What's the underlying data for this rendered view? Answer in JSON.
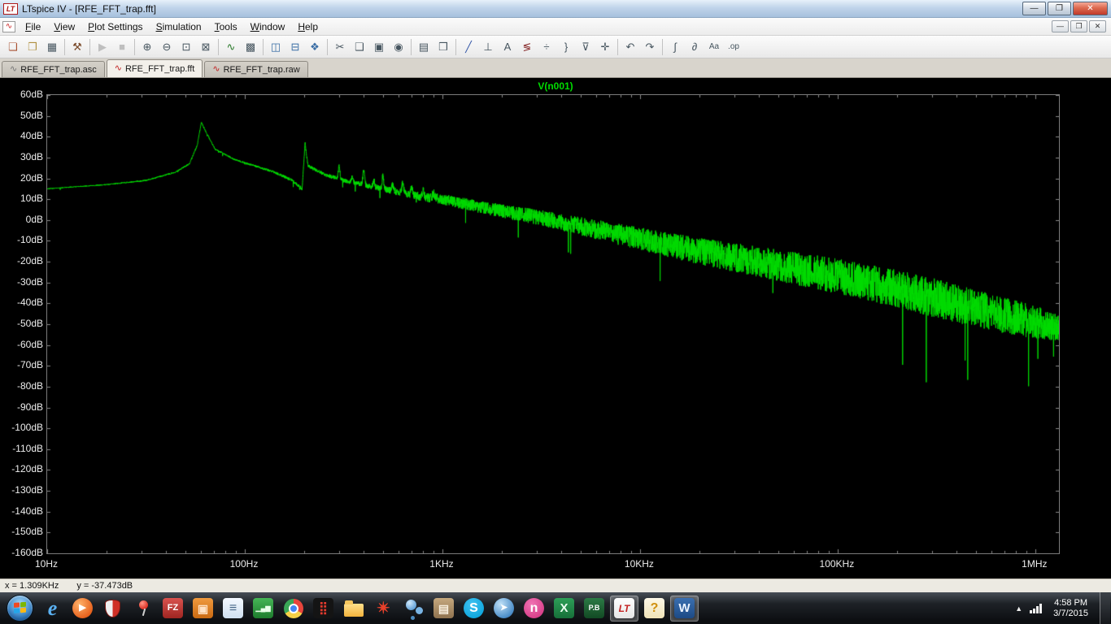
{
  "window": {
    "title": "LTspice IV - [RFE_FFT_trap.fft]",
    "logo_text": "LT",
    "controls": {
      "minimize": "—",
      "restore": "❐",
      "close": "✕"
    },
    "mdi_controls": {
      "minimize": "—",
      "restore": "❐",
      "close": "✕"
    }
  },
  "menu": {
    "doc_icon_glyph": "∿",
    "items": [
      "File",
      "View",
      "Plot Settings",
      "Simulation",
      "Tools",
      "Window",
      "Help"
    ]
  },
  "toolbar": {
    "buttons": [
      {
        "name": "new-schematic",
        "glyph": "❏",
        "fg": "#a85030"
      },
      {
        "name": "open",
        "glyph": "❐",
        "fg": "#b09040"
      },
      {
        "name": "save",
        "glyph": "▦",
        "fg": "#46555f"
      },
      {
        "sep": true
      },
      {
        "name": "control-panel",
        "glyph": "⚒",
        "fg": "#7a4a2a"
      },
      {
        "sep": true
      },
      {
        "name": "run",
        "glyph": "▶",
        "enabled": false
      },
      {
        "name": "halt",
        "glyph": "■",
        "enabled": false
      },
      {
        "sep": true
      },
      {
        "name": "zoom-in",
        "glyph": "⊕"
      },
      {
        "name": "zoom-out",
        "glyph": "⊖"
      },
      {
        "name": "zoom-area",
        "glyph": "⊡"
      },
      {
        "name": "zoom-full-extents",
        "glyph": "⊠"
      },
      {
        "sep": true
      },
      {
        "name": "autorange-y-axis",
        "glyph": "∿",
        "fg": "#2a7a2a"
      },
      {
        "name": "grid",
        "glyph": "▩"
      },
      {
        "sep": true
      },
      {
        "name": "tile-vertically",
        "glyph": "◫",
        "fg": "#3a6ea5"
      },
      {
        "name": "tile-horizontally",
        "glyph": "⊟",
        "fg": "#3a6ea5"
      },
      {
        "name": "cascade-windows",
        "glyph": "❖",
        "fg": "#3a6ea5"
      },
      {
        "sep": true
      },
      {
        "name": "cut",
        "glyph": "✂"
      },
      {
        "name": "copy",
        "glyph": "❑"
      },
      {
        "name": "paste",
        "glyph": "▣"
      },
      {
        "name": "find",
        "glyph": "◉"
      },
      {
        "sep": true
      },
      {
        "name": "print",
        "glyph": "▤"
      },
      {
        "name": "print-preview",
        "glyph": "❒"
      },
      {
        "sep": true
      },
      {
        "name": "draw-wire",
        "glyph": "╱",
        "fg": "#3558a8"
      },
      {
        "name": "ground",
        "glyph": "⊥"
      },
      {
        "name": "net-label",
        "glyph": "A"
      },
      {
        "name": "diode",
        "glyph": "≶",
        "fg": "#8a3030"
      },
      {
        "name": "capacitor",
        "glyph": "÷"
      },
      {
        "name": "inductor",
        "glyph": "}"
      },
      {
        "name": "component",
        "glyph": "⊽"
      },
      {
        "name": "move",
        "glyph": "✛"
      },
      {
        "sep": true
      },
      {
        "name": "undo",
        "glyph": "↶"
      },
      {
        "name": "redo",
        "glyph": "↷"
      },
      {
        "sep": true
      },
      {
        "name": "mirror",
        "glyph": "∫"
      },
      {
        "name": "rotate",
        "glyph": "∂"
      },
      {
        "name": "text",
        "glyph": "Aa"
      },
      {
        "name": "spice-directive",
        "glyph": ".op"
      }
    ]
  },
  "tabs": [
    {
      "label": "RFE_FFT_trap.asc",
      "glyph": "∿",
      "glyph_color": "#767676",
      "active": false
    },
    {
      "label": "RFE_FFT_trap.fft",
      "glyph": "∿",
      "glyph_color": "#c22222",
      "active": true
    },
    {
      "label": "RFE_FFT_trap.raw",
      "glyph": "∿",
      "glyph_color": "#c22222",
      "active": false
    }
  ],
  "status_bar": {
    "x_readout": "x = 1.309KHz",
    "y_readout": "y = -37.473dB"
  },
  "taskbar": {
    "tray": {
      "expand_glyph": "▲",
      "time": "4:58 PM",
      "date": "3/7/2015"
    },
    "icons": [
      {
        "name": "internet-explorer",
        "type": "glyph",
        "glyph": "e",
        "fg": "#5ab1f2",
        "bg": "transparent",
        "shape": "none",
        "font": "serif-italic",
        "size": 26
      },
      {
        "name": "media-player",
        "type": "glyph",
        "glyph": "▶",
        "fg": "#ffffff",
        "bg": "radial-gradient(circle at 35% 30%,#ffb36b,#e8641f 70%,#b84a10)",
        "shape": "circle",
        "size": 11
      },
      {
        "name": "antivirus-shield",
        "type": "shield"
      },
      {
        "name": "pushpin",
        "type": "pin"
      },
      {
        "name": "filezilla",
        "type": "glyph",
        "glyph": "FZ",
        "fg": "#ffffff",
        "bg": "linear-gradient(#d9534f,#9e2521)",
        "shape": "square",
        "size": 11
      },
      {
        "name": "utility-orange",
        "type": "glyph",
        "glyph": "▣",
        "fg": "#ffe2c4",
        "bg": "linear-gradient(#f09a3e,#c96a12)",
        "shape": "square",
        "size": 14
      },
      {
        "name": "notes",
        "type": "glyph",
        "glyph": "≡",
        "fg": "#4a6a8a",
        "bg": "linear-gradient(#f4f9ff,#cfe0f0)",
        "shape": "square",
        "size": 16
      },
      {
        "name": "monitor-green",
        "type": "glyph",
        "glyph": "▁▄▆",
        "fg": "#eaffea",
        "bg": "linear-gradient(#46b556,#1e7c2e)",
        "shape": "square",
        "size": 8
      },
      {
        "name": "chrome",
        "type": "chrome"
      },
      {
        "name": "dots-black",
        "type": "glyph",
        "glyph": "⣿",
        "fg": "#e23b2e",
        "bg": "#141414",
        "shape": "square",
        "size": 15
      },
      {
        "name": "file-explorer",
        "type": "folder"
      },
      {
        "name": "red-star",
        "type": "glyph",
        "glyph": "✴",
        "fg": "#e8402a",
        "bg": "transparent",
        "shape": "none",
        "size": 20
      },
      {
        "name": "bubbles-blue",
        "type": "bubbles"
      },
      {
        "name": "archive-tan",
        "type": "glyph",
        "glyph": "▤",
        "fg": "#f7eede",
        "bg": "linear-gradient(#c5a87e,#8f7350)",
        "shape": "square",
        "size": 14
      },
      {
        "name": "skype",
        "type": "glyph",
        "glyph": "S",
        "fg": "#ffffff",
        "bg": "radial-gradient(circle at 40% 30%,#3fc1f0,#009ed8)",
        "shape": "circle",
        "size": 16
      },
      {
        "name": "globe-pointer",
        "type": "glyph",
        "glyph": "➤",
        "fg": "#ffffff",
        "bg": "radial-gradient(circle at 35% 30%,#bfe0f7,#4d8fc9 70%,#29598c)",
        "shape": "circle",
        "size": 11
      },
      {
        "name": "nexus-pink",
        "type": "glyph",
        "glyph": "n",
        "fg": "#ffffff",
        "bg": "radial-gradient(circle at 40% 30%,#f073b4,#cf2f7b)",
        "shape": "circle",
        "size": 16
      },
      {
        "name": "excel",
        "type": "glyph",
        "glyph": "X",
        "fg": "#eafff0",
        "bg": "linear-gradient(#2d9e57,#17703a)",
        "shape": "square",
        "size": 15
      },
      {
        "name": "powerbuilder",
        "type": "glyph",
        "glyph": "P.B",
        "fg": "#ffffff",
        "bg": "linear-gradient(#2c7a45,#124a24)",
        "shape": "square",
        "size": 9
      },
      {
        "name": "ltspice",
        "type": "glyph",
        "glyph": "LT",
        "fg": "#c32222",
        "bg": "linear-gradient(#ffffff,#e6e6e6)",
        "shape": "square",
        "size": 12,
        "italic": true,
        "running": true
      },
      {
        "name": "help",
        "type": "glyph",
        "glyph": "?",
        "fg": "#d09010",
        "bg": "linear-gradient(#fdf8e8,#efe3b8)",
        "shape": "square",
        "size": 16
      },
      {
        "name": "word",
        "type": "glyph",
        "glyph": "W",
        "fg": "#eaf2ff",
        "bg": "linear-gradient(#3a6fb0,#1d4a85)",
        "shape": "square",
        "size": 15,
        "running": true
      }
    ]
  },
  "chart_data": {
    "type": "line",
    "title": "V(n001)",
    "x_scale": "log",
    "x_unit": "Hz",
    "x_range_hz": [
      10,
      1318257
    ],
    "x_ticks": [
      {
        "hz": 10,
        "label": "10Hz"
      },
      {
        "hz": 100,
        "label": "100Hz"
      },
      {
        "hz": 1000,
        "label": "1KHz"
      },
      {
        "hz": 10000,
        "label": "10KHz"
      },
      {
        "hz": 100000,
        "label": "100KHz"
      },
      {
        "hz": 1000000,
        "label": "1MHz"
      }
    ],
    "y_unit": "dB",
    "y_range_db": [
      -160,
      60
    ],
    "y_tick_step_db": 10,
    "y_tick_labels": [
      "60dB",
      "50dB",
      "40dB",
      "30dB",
      "20dB",
      "10dB",
      "0dB",
      "-10dB",
      "-20dB",
      "-30dB",
      "-40dB",
      "-50dB",
      "-60dB",
      "-70dB",
      "-80dB",
      "-90dB",
      "-100dB",
      "-110dB",
      "-120dB",
      "-130dB",
      "-140dB",
      "-150dB",
      "-160dB"
    ],
    "grid": false,
    "background": "#000000",
    "series": [
      {
        "name": "V(n001)",
        "color": "#00dc00",
        "envelope_log10hz_db": [
          [
            1.0,
            15
          ],
          [
            1.3,
            17
          ],
          [
            1.5,
            19
          ],
          [
            1.65,
            23
          ],
          [
            1.72,
            27
          ],
          [
            1.76,
            36
          ],
          [
            1.78,
            47
          ],
          [
            1.8,
            43
          ],
          [
            1.85,
            34
          ],
          [
            1.95,
            29
          ],
          [
            2.05,
            26
          ],
          [
            2.15,
            23
          ],
          [
            2.24,
            19
          ],
          [
            2.29,
            15
          ],
          [
            2.305,
            37
          ],
          [
            2.32,
            26
          ],
          [
            2.4,
            22
          ],
          [
            2.5,
            19
          ],
          [
            2.6,
            17
          ],
          [
            2.7,
            15
          ],
          [
            2.8,
            13
          ],
          [
            2.9,
            11
          ],
          [
            3.0,
            10
          ],
          [
            3.2,
            6
          ],
          [
            3.5,
            1
          ],
          [
            3.7,
            -3
          ],
          [
            4.0,
            -9
          ],
          [
            4.3,
            -15
          ],
          [
            4.6,
            -20
          ],
          [
            5.0,
            -27
          ],
          [
            5.3,
            -33
          ],
          [
            5.6,
            -40
          ],
          [
            5.85,
            -46
          ],
          [
            6.0,
            -49
          ],
          [
            6.12,
            -52
          ]
        ],
        "noise_halfwidth_db": [
          [
            1.0,
            0.2
          ],
          [
            2.0,
            0.4
          ],
          [
            2.5,
            1.0
          ],
          [
            2.8,
            1.8
          ],
          [
            3.0,
            2.5
          ],
          [
            3.3,
            3.2
          ],
          [
            3.6,
            4.0
          ],
          [
            4.0,
            5.5
          ],
          [
            4.5,
            7.0
          ],
          [
            5.0,
            8.5
          ],
          [
            5.5,
            9.5
          ],
          [
            5.9,
            8.5
          ],
          [
            6.12,
            7.0
          ]
        ],
        "harmonic_peaks_hz_db": [
          [
            300,
            26
          ],
          [
            350,
            21
          ],
          [
            400,
            24
          ],
          [
            450,
            19
          ],
          [
            500,
            21
          ],
          [
            560,
            17
          ],
          [
            630,
            18
          ],
          [
            700,
            16
          ],
          [
            800,
            14
          ],
          [
            900,
            13
          ],
          [
            1100,
            10
          ],
          [
            1300,
            8
          ]
        ]
      }
    ]
  }
}
